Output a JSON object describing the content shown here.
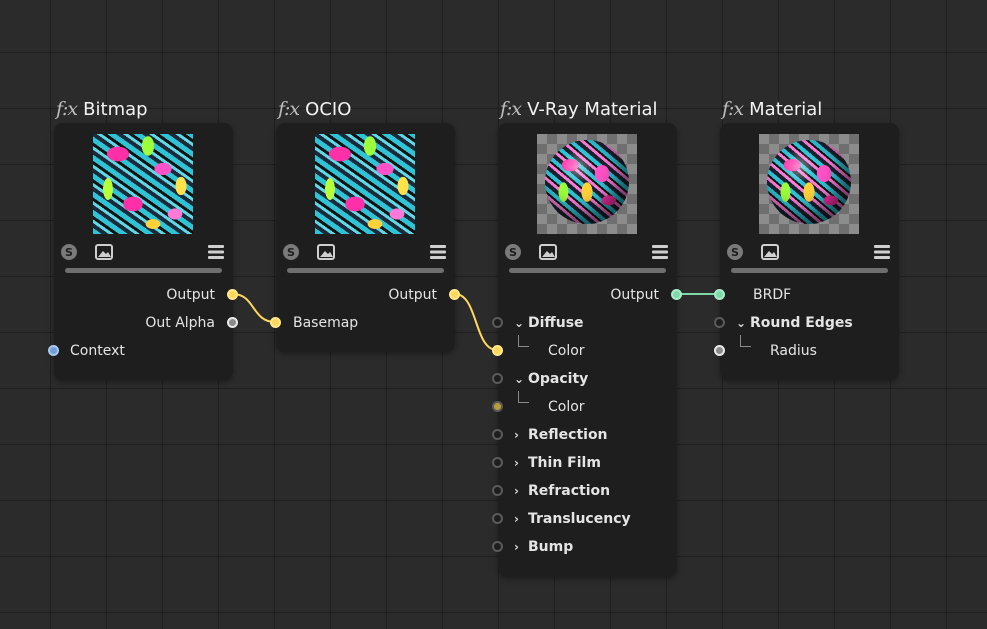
{
  "fx_label": "f:x",
  "colors": {
    "canvas": "#2b2b2b",
    "node": "#1e1e1e",
    "wire_yellow": "#ffd75a",
    "wire_green": "#7fd8a8",
    "port_blue": "#6f9fd6"
  },
  "nodes": {
    "bitmap": {
      "title": "Bitmap",
      "outputs": [
        "Output",
        "Out Alpha"
      ],
      "inputs": [
        "Context"
      ]
    },
    "ocio": {
      "title": "OCIO",
      "outputs": [
        "Output"
      ],
      "inputs": [
        "Basemap"
      ]
    },
    "vray": {
      "title": "V-Ray Material",
      "outputs": [
        "Output"
      ],
      "sections": [
        {
          "label": "Diffuse",
          "sub": "Color"
        },
        {
          "label": "Opacity",
          "sub": "Color"
        },
        {
          "label": "Reflection"
        },
        {
          "label": "Thin Film"
        },
        {
          "label": "Refraction"
        },
        {
          "label": "Translucency"
        },
        {
          "label": "Bump"
        }
      ]
    },
    "material": {
      "title": "Material",
      "inputs": [
        "BRDF"
      ],
      "sections": [
        {
          "label": "Round Edges",
          "sub": "Radius"
        }
      ]
    }
  },
  "icons": [
    "s-icon",
    "image-icon",
    "menu-icon",
    "chevron-down-icon",
    "chevron-right-icon"
  ]
}
